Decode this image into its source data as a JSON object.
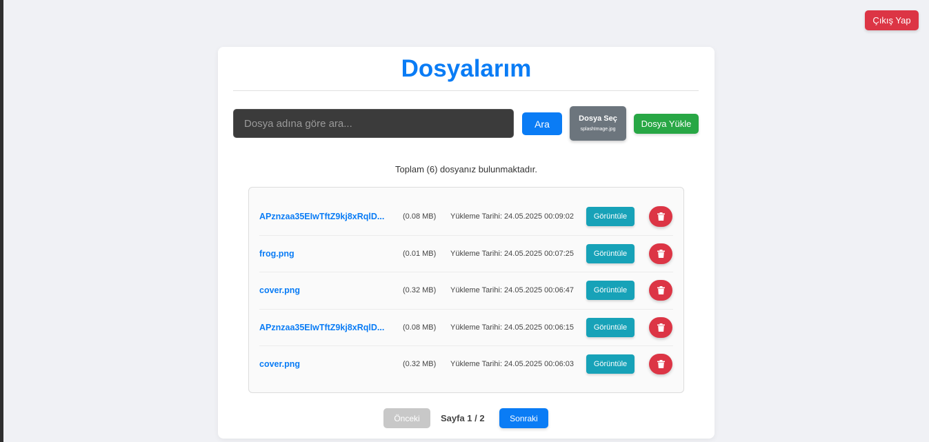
{
  "header": {
    "logout_label": "Çıkış Yap"
  },
  "main": {
    "title": "Dosyalarım",
    "search": {
      "placeholder": "Dosya adına göre ara...",
      "value": "",
      "button_label": "Ara"
    },
    "choose_file": {
      "label": "Dosya Seç",
      "selected_file": "splashImage.jpg"
    },
    "upload_label": "Dosya Yükle",
    "count_text": "Toplam (6) dosyanız bulunmaktadır.",
    "files": [
      {
        "name": "APznzaa35EIwTftZ9kj8xRqlD...",
        "size": "(0.08 MB)",
        "date": "Yükleme Tarihi: 24.05.2025 00:09:02",
        "view_label": "Görüntüle"
      },
      {
        "name": "frog.png",
        "size": "(0.01 MB)",
        "date": "Yükleme Tarihi: 24.05.2025 00:07:25",
        "view_label": "Görüntüle"
      },
      {
        "name": "cover.png",
        "size": "(0.32 MB)",
        "date": "Yükleme Tarihi: 24.05.2025 00:06:47",
        "view_label": "Görüntüle"
      },
      {
        "name": "APznzaa35EIwTftZ9kj8xRqlD...",
        "size": "(0.08 MB)",
        "date": "Yükleme Tarihi: 24.05.2025 00:06:15",
        "view_label": "Görüntüle"
      },
      {
        "name": "cover.png",
        "size": "(0.32 MB)",
        "date": "Yükleme Tarihi: 24.05.2025 00:06:03",
        "view_label": "Görüntüle"
      }
    ],
    "delete_icon": "trash-icon"
  },
  "pagination": {
    "prev_label": "Önceki",
    "page_label": "Sayfa 1 / 2",
    "next_label": "Sonraki"
  },
  "colors": {
    "accent": "#0a7cf5",
    "danger": "#dc3545",
    "success": "#28a745",
    "info": "#17a2b8",
    "secondary": "#6c757d",
    "disabled": "#c8c8c8"
  }
}
